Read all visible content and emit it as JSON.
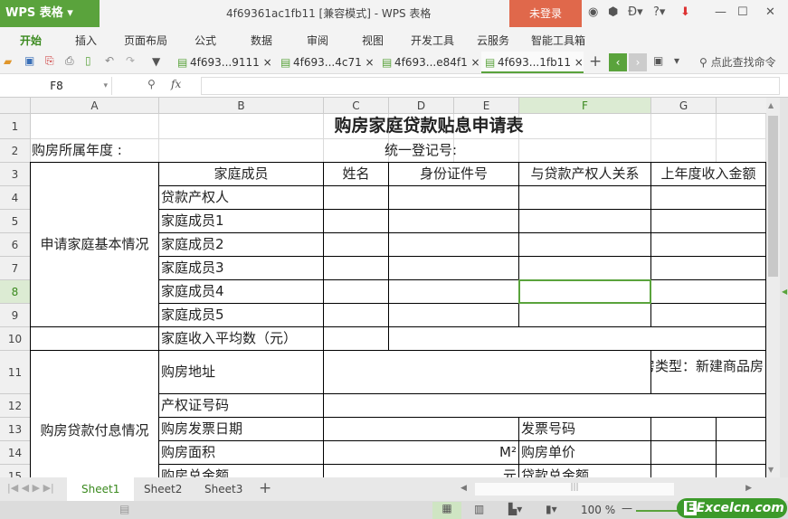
{
  "app": {
    "logo": "WPS 表格",
    "title": "4f69361ac1fb11 [兼容模式] - WPS 表格",
    "login": "未登录"
  },
  "menu": [
    "开始",
    "插入",
    "页面布局",
    "公式",
    "数据",
    "审阅",
    "视图",
    "开发工具",
    "云服务",
    "智能工具箱"
  ],
  "doc_tabs": [
    "4f693...9111",
    "4f693...4c71",
    "4f693...e84f1",
    "4f693...1fb11"
  ],
  "search_cmd": "点此查找命令",
  "namebox": "F8",
  "fx": "fx",
  "columns": [
    "A",
    "B",
    "C",
    "D",
    "E",
    "F",
    "G"
  ],
  "rows": [
    "1",
    "2",
    "3",
    "4",
    "5",
    "6",
    "7",
    "8",
    "9",
    "10",
    "11",
    "12",
    "13",
    "14",
    "15"
  ],
  "selected": {
    "col": "F",
    "row": "8"
  },
  "cells": [
    {
      "r": 1,
      "c": 0,
      "rs": 1,
      "cs": 8,
      "t": "购房家庭贷款贴息申请表",
      "a": "c",
      "nb": true,
      "b": true
    },
    {
      "r": 2,
      "c": 0,
      "rs": 1,
      "cs": 2,
      "t": "购房所属年度 :",
      "a": "l",
      "nb": true
    },
    {
      "r": 2,
      "c": 3,
      "rs": 1,
      "cs": 2,
      "t": "统一登记号:",
      "a": "l",
      "nb": true
    },
    {
      "r": 3,
      "c": 0,
      "rs": 7,
      "cs": 1,
      "t": "申请家庭基本情况",
      "a": "c"
    },
    {
      "r": 3,
      "c": 1,
      "rs": 1,
      "cs": 1,
      "t": "家庭成员",
      "a": "c"
    },
    {
      "r": 3,
      "c": 2,
      "rs": 1,
      "cs": 1,
      "t": "姓名",
      "a": "c"
    },
    {
      "r": 3,
      "c": 3,
      "rs": 1,
      "cs": 2,
      "t": "身份证件号",
      "a": "c"
    },
    {
      "r": 3,
      "c": 5,
      "rs": 1,
      "cs": 1,
      "t": "与贷款产权人关系",
      "a": "c"
    },
    {
      "r": 3,
      "c": 6,
      "rs": 1,
      "cs": 2,
      "t": "上年度收入金额",
      "a": "c"
    },
    {
      "r": 4,
      "c": 1,
      "t": "贷款产权人",
      "a": "l"
    },
    {
      "r": 5,
      "c": 1,
      "t": "家庭成员1",
      "a": "l"
    },
    {
      "r": 6,
      "c": 1,
      "t": "家庭成员2",
      "a": "l"
    },
    {
      "r": 7,
      "c": 1,
      "t": "家庭成员3",
      "a": "l"
    },
    {
      "r": 8,
      "c": 1,
      "t": "家庭成员4",
      "a": "l"
    },
    {
      "r": 9,
      "c": 1,
      "t": "家庭成员5",
      "a": "l"
    },
    {
      "r": 10,
      "c": 0,
      "t": ""
    },
    {
      "r": 10,
      "c": 1,
      "t": "家庭收入平均数（元）",
      "a": "l"
    },
    {
      "r": 10,
      "c": 2,
      "t": ""
    },
    {
      "r": 10,
      "c": 3,
      "cs": 5,
      "t": ""
    },
    {
      "r": 11,
      "c": 0,
      "rs": 6,
      "cs": 1,
      "t": "购房贷款付息情况",
      "a": "c"
    },
    {
      "r": 11,
      "c": 1,
      "t": "购房地址",
      "a": "l"
    },
    {
      "r": 11,
      "c": 2,
      "cs": 4,
      "t": ""
    },
    {
      "r": 11,
      "c": 6,
      "cs": 2,
      "t": "住房类型：新建商品房",
      "a": "r"
    },
    {
      "r": 12,
      "c": 1,
      "t": "产权证号码",
      "a": "l"
    },
    {
      "r": 12,
      "c": 2,
      "cs": 6,
      "t": ""
    },
    {
      "r": 13,
      "c": 1,
      "t": "购房发票日期",
      "a": "l"
    },
    {
      "r": 13,
      "c": 2,
      "cs": 3,
      "t": ""
    },
    {
      "r": 13,
      "c": 5,
      "t": "发票号码",
      "a": "l"
    },
    {
      "r": 13,
      "c": 6,
      "t": ""
    },
    {
      "r": 13,
      "c": 7,
      "t": ""
    },
    {
      "r": 14,
      "c": 1,
      "t": "购房面积",
      "a": "l"
    },
    {
      "r": 14,
      "c": 2,
      "cs": 3,
      "t": "M²",
      "a": "r"
    },
    {
      "r": 14,
      "c": 5,
      "t": "购房单价",
      "a": "l"
    },
    {
      "r": 14,
      "c": 6,
      "t": ""
    },
    {
      "r": 14,
      "c": 7,
      "t": ""
    },
    {
      "r": 15,
      "c": 1,
      "t": "购房总金额",
      "a": "l"
    },
    {
      "r": 15,
      "c": 2,
      "cs": 3,
      "t": "元",
      "a": "r"
    },
    {
      "r": 15,
      "c": 5,
      "t": "贷款总金额",
      "a": "l"
    },
    {
      "r": 15,
      "c": 6,
      "t": ""
    },
    {
      "r": 15,
      "c": 7,
      "t": ""
    }
  ],
  "sheets": [
    "Sheet1",
    "Sheet2",
    "Sheet3"
  ],
  "active_sheet": "Sheet1",
  "zoom": "100 %",
  "watermark": "Excelcn.com",
  "colors": {
    "accent": "#5aa33c",
    "login": "#e0684b"
  }
}
